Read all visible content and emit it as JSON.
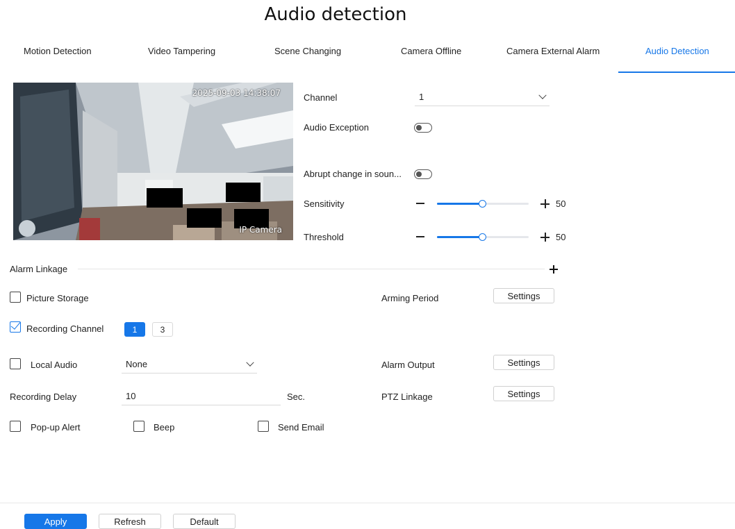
{
  "page_title": "Audio detection",
  "tabs": [
    {
      "label": "Motion Detection",
      "active": false
    },
    {
      "label": "Video Tampering",
      "active": false
    },
    {
      "label": "Scene Changing",
      "active": false
    },
    {
      "label": "Camera Offline",
      "active": false
    },
    {
      "label": "Camera External Alarm",
      "active": false
    },
    {
      "label": "Audio Detection",
      "active": true
    }
  ],
  "preview": {
    "timestamp": "2025-09-03 14:38:07",
    "camera_name": "IP Camera"
  },
  "settings": {
    "channel_label": "Channel",
    "channel_value": "1",
    "audio_exception_label": "Audio Exception",
    "audio_exception_on": false,
    "abrupt_change_label": "Abrupt change in soun...",
    "abrupt_change_on": false,
    "sensitivity_label": "Sensitivity",
    "sensitivity_value": "50",
    "threshold_label": "Threshold",
    "threshold_value": "50"
  },
  "alarm_linkage": {
    "title": "Alarm Linkage",
    "picture_storage_label": "Picture Storage",
    "picture_storage_checked": false,
    "recording_channel_label": "Recording Channel",
    "recording_channel_checked": true,
    "recording_channels": [
      {
        "label": "1",
        "selected": true
      },
      {
        "label": "3",
        "selected": false
      }
    ],
    "local_audio_label": "Local Audio",
    "local_audio_checked": false,
    "local_audio_value": "None",
    "recording_delay_label": "Recording Delay",
    "recording_delay_value": "10",
    "recording_delay_unit": "Sec.",
    "popup_alert_label": "Pop-up Alert",
    "beep_label": "Beep",
    "send_email_label": "Send Email",
    "arming_period_label": "Arming Period",
    "alarm_output_label": "Alarm Output",
    "ptz_linkage_label": "PTZ Linkage",
    "settings_button_label": "Settings"
  },
  "footer": {
    "apply_label": "Apply",
    "refresh_label": "Refresh",
    "default_label": "Default"
  },
  "colors": {
    "accent": "#1677e8"
  }
}
